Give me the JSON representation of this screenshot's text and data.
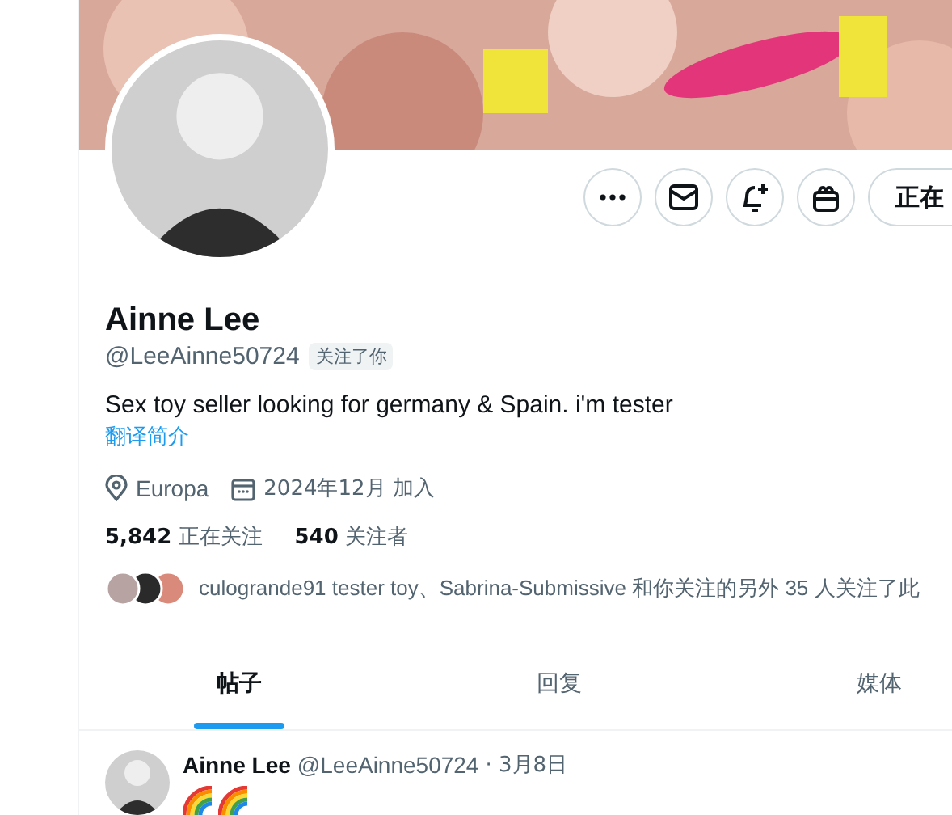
{
  "actions": [
    {
      "kind": "more"
    },
    {
      "kind": "message"
    },
    {
      "kind": "notify"
    },
    {
      "kind": "gift"
    },
    {
      "kind": "follow",
      "label": "正在"
    }
  ],
  "profile": {
    "name": "Ainne Lee",
    "handle": "@LeeAinne50724",
    "follows_you": "关注了你",
    "bio": "Sex toy seller looking for germany & Spain. i'm tester",
    "translate": "翻译简介",
    "location": "Europa",
    "joined": "2024年12月 加入"
  },
  "stats": [
    {
      "count": "5,842",
      "label": "正在关注"
    },
    {
      "count": "540",
      "label": "关注者"
    }
  ],
  "followers_you_know": {
    "text": "culogrande91 tester toy、Sabrina-Submissive 和你关注的另外 35 人关注了此"
  },
  "tabs": [
    {
      "label": "帖子",
      "selected": true
    },
    {
      "label": "回复",
      "selected": false
    },
    {
      "label": "媒体",
      "selected": false
    }
  ],
  "post": {
    "name": "Ainne Lee",
    "handle": "@LeeAinne50724",
    "date": "· 3月8日",
    "emojis": [
      {
        "kind": "rainbow"
      },
      {
        "kind": "rainbow"
      }
    ]
  }
}
